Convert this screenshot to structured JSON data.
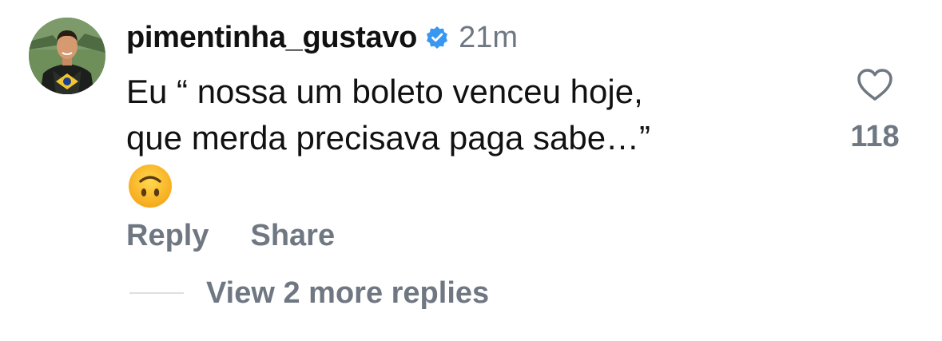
{
  "comment": {
    "username": "pimentinha_gustavo",
    "verified": true,
    "timestamp": "21m",
    "text": "Eu “ nossa um boleto venceu hoje,\nque merda precisava paga sabe…”",
    "emoji": "upside-down-face",
    "like_count": "118",
    "actions": {
      "reply": "Reply",
      "share": "Share"
    },
    "view_replies": "View 2 more replies"
  },
  "colors": {
    "text_primary": "#111111",
    "text_secondary": "#6f7782",
    "verified_blue": "#3897f0",
    "divider": "#dcdfe3"
  },
  "icons": {
    "verified": "verified-badge-icon",
    "like": "heart-outline-icon"
  }
}
